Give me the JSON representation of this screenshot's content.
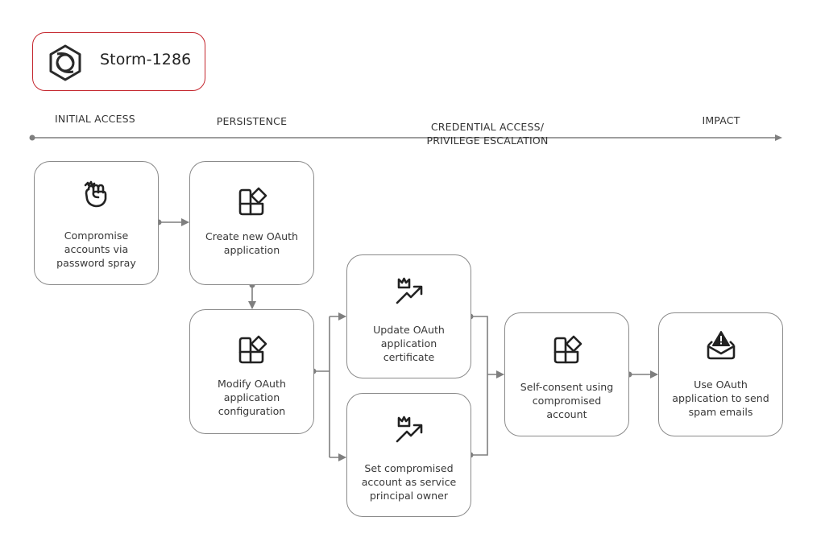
{
  "actor": {
    "name": "Storm-1286",
    "icon": "hexagon-ring-icon",
    "border_color": "#c4262e"
  },
  "timeline": {
    "phases": [
      {
        "id": "initial-access",
        "label": "INITIAL ACCESS"
      },
      {
        "id": "persistence",
        "label": "PERSISTENCE"
      },
      {
        "id": "credential-access",
        "label": "CREDENTIAL ACCESS/\nPRIVILEGE ESCALATION"
      },
      {
        "id": "impact",
        "label": "IMPACT"
      }
    ]
  },
  "nodes": [
    {
      "id": "password-spray",
      "icon": "fist-icon",
      "label": "Compromise\naccounts via\npassword spray"
    },
    {
      "id": "create-oauth",
      "icon": "app-grid-icon",
      "label": "Create new OAuth\napplication"
    },
    {
      "id": "modify-oauth",
      "icon": "app-grid-icon",
      "label": "Modify OAuth\napplication\nconfiguration"
    },
    {
      "id": "update-cert",
      "icon": "crown-trend-icon",
      "label": "Update OAuth\napplication\ncertificate"
    },
    {
      "id": "set-owner",
      "icon": "crown-trend-icon",
      "label": "Set compromised\naccount as service\nprincipal owner"
    },
    {
      "id": "self-consent",
      "icon": "app-grid-icon",
      "label": "Self-consent using\ncompromised\naccount"
    },
    {
      "id": "spam",
      "icon": "mail-warning-icon",
      "label": "Use OAuth\napplication to send\nspam emails"
    }
  ],
  "edges": [
    {
      "from": "password-spray",
      "to": "create-oauth"
    },
    {
      "from": "create-oauth",
      "to": "modify-oauth"
    },
    {
      "from": "modify-oauth",
      "to": "update-cert"
    },
    {
      "from": "modify-oauth",
      "to": "set-owner"
    },
    {
      "from": "update-cert",
      "to": "self-consent"
    },
    {
      "from": "set-owner",
      "to": "self-consent"
    },
    {
      "from": "self-consent",
      "to": "spam"
    }
  ],
  "colors": {
    "line": "#7f7f7f",
    "node_border": "#8a8a8a",
    "icon": "#222222",
    "text": "#383838"
  }
}
